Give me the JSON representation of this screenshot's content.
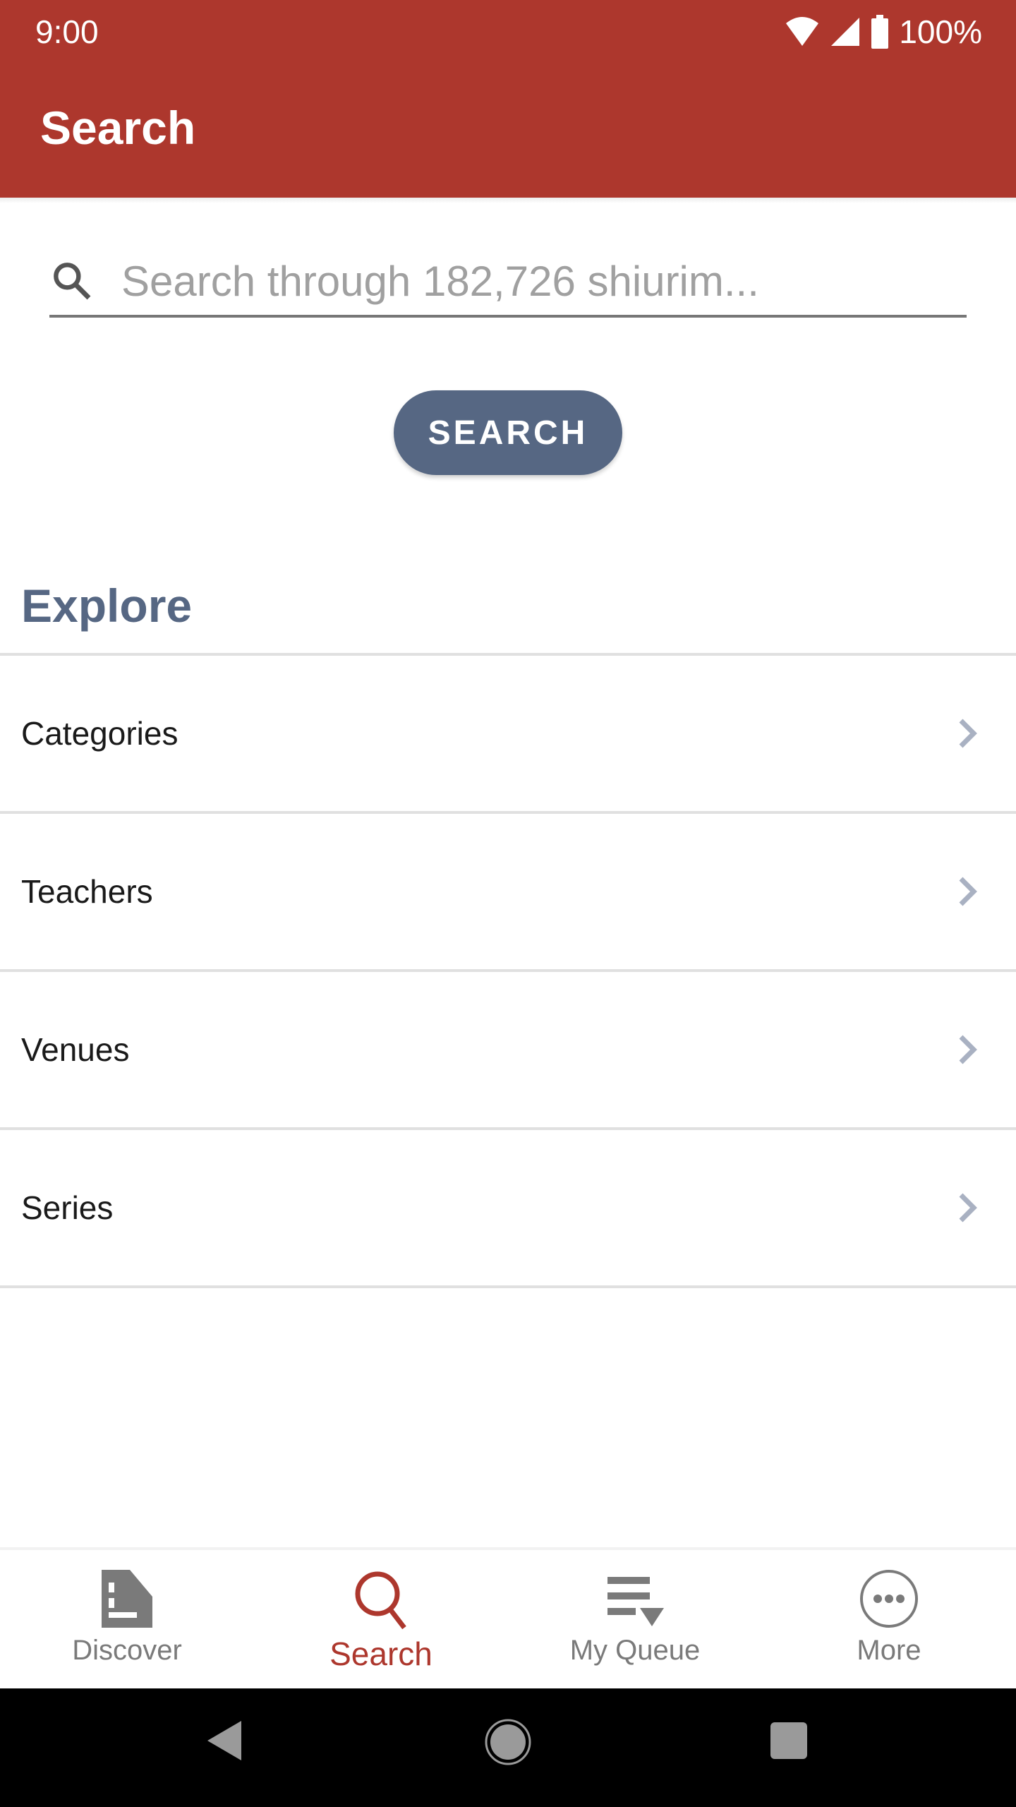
{
  "status_bar": {
    "time": "9:00",
    "battery": "100%",
    "icons": [
      "wifi-icon",
      "signal-icon",
      "battery-icon"
    ]
  },
  "app_bar": {
    "title": "Search"
  },
  "search": {
    "placeholder": "Search through 182,726 shiurim...",
    "value": "",
    "button_label": "SEARCH"
  },
  "explore": {
    "heading": "Explore",
    "items": [
      {
        "label": "Categories",
        "icon": "chevron-right-icon"
      },
      {
        "label": "Teachers",
        "icon": "chevron-right-icon"
      },
      {
        "label": "Venues",
        "icon": "chevron-right-icon"
      },
      {
        "label": "Series",
        "icon": "chevron-right-icon"
      }
    ]
  },
  "bottom_nav": {
    "tabs": [
      {
        "label": "Discover",
        "icon": "discover-icon",
        "active": false
      },
      {
        "label": "Search",
        "icon": "search-icon",
        "active": true
      },
      {
        "label": "My Queue",
        "icon": "queue-icon",
        "active": false
      },
      {
        "label": "More",
        "icon": "more-icon",
        "active": false
      }
    ]
  },
  "colors": {
    "primary": "#ad372d",
    "accent": "#566783",
    "chevron": "#a9b1c2",
    "inactive": "#7a7a7a"
  }
}
